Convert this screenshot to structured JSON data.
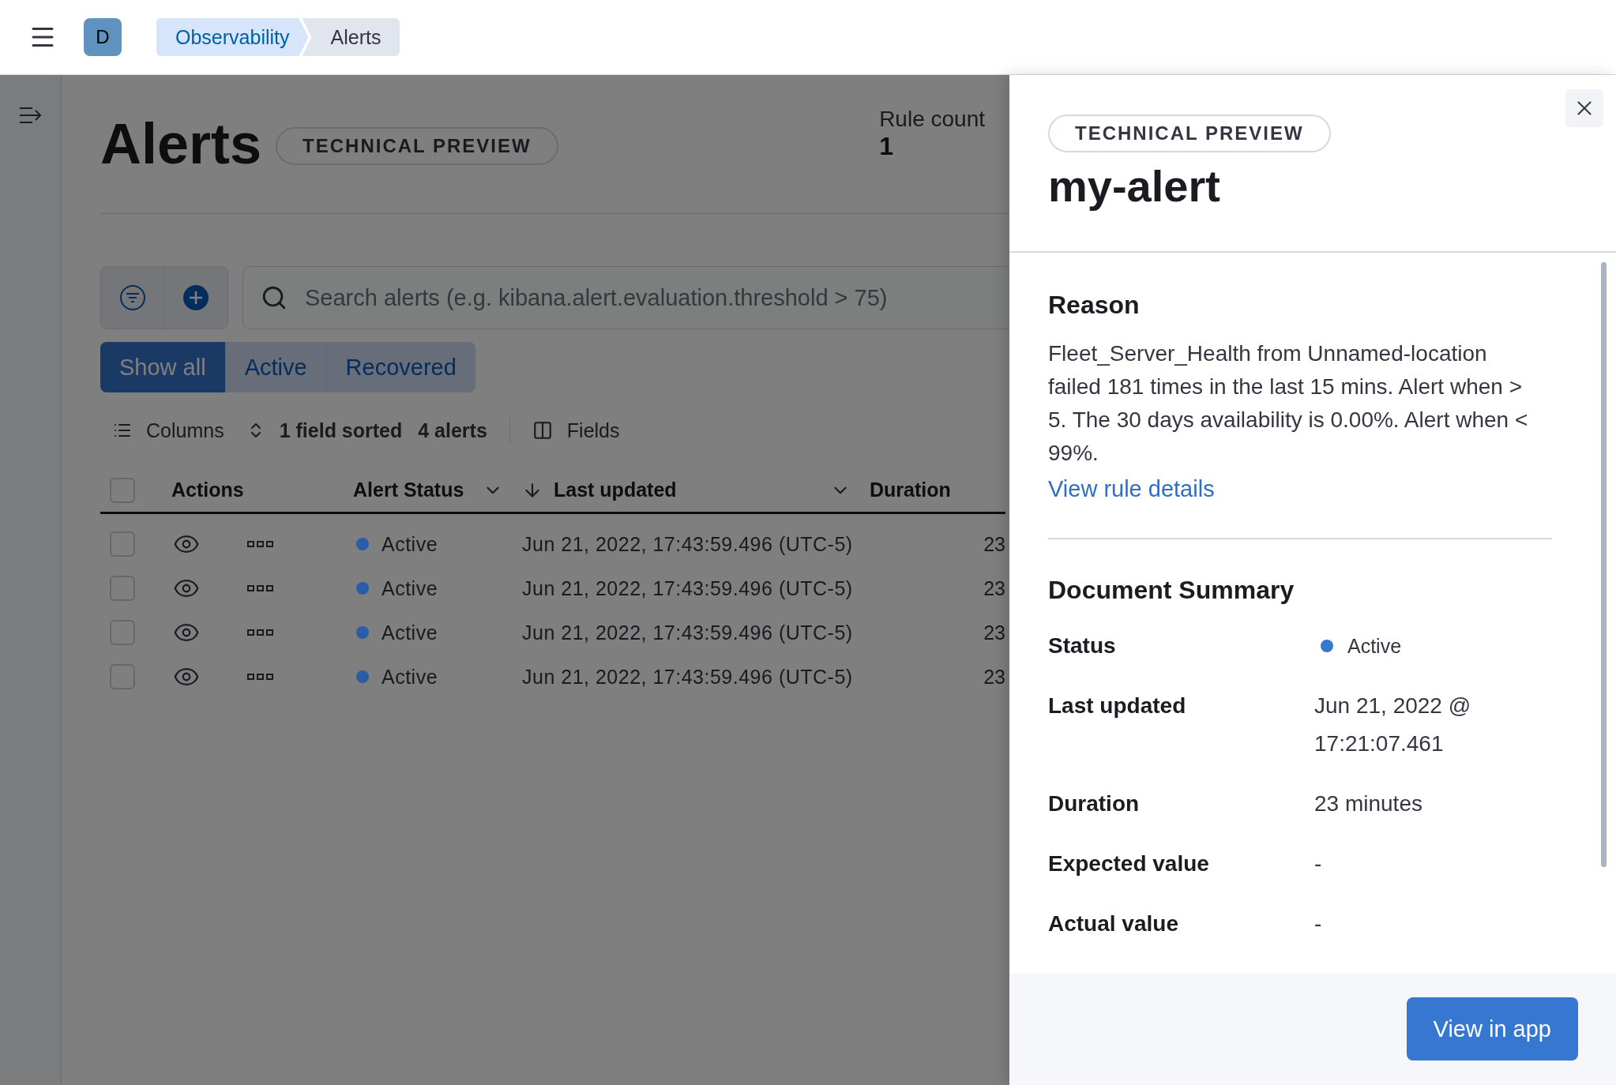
{
  "header": {
    "avatar": "D",
    "breadcrumbs": [
      {
        "label": "Observability",
        "selected": false
      },
      {
        "label": "Alerts",
        "selected": true
      }
    ]
  },
  "page": {
    "title": "Alerts",
    "badge": "TECHNICAL PREVIEW",
    "stats": [
      {
        "label": "Rule count",
        "value": "1"
      }
    ]
  },
  "search": {
    "placeholder": "Search alerts (e.g. kibana.alert.evaluation.threshold > 75)"
  },
  "filters": [
    {
      "label": "Show all",
      "selected": true
    },
    {
      "label": "Active",
      "selected": false
    },
    {
      "label": "Recovered",
      "selected": false
    }
  ],
  "toolbar": {
    "columns": "Columns",
    "sorted": "1 field sorted",
    "count": "4 alerts",
    "fields": "Fields"
  },
  "table": {
    "select_all_checked": false,
    "columns": [
      {
        "label": "Actions",
        "kind": "plain"
      },
      {
        "label": "Alert Status",
        "kind": "menu"
      },
      {
        "label": "Last updated",
        "kind": "sorted"
      },
      {
        "label": "Duration",
        "kind": "plain"
      }
    ],
    "rows": [
      {
        "checked": false,
        "status": "Active",
        "color": "#2a5da8",
        "updated": "Jun 21, 2022, 17:43:59.496 (UTC-5)",
        "duration": "23"
      },
      {
        "checked": false,
        "status": "Active",
        "color": "#2a5da8",
        "updated": "Jun 21, 2022, 17:43:59.496 (UTC-5)",
        "duration": "23"
      },
      {
        "checked": false,
        "status": "Active",
        "color": "#2a5da8",
        "updated": "Jun 21, 2022, 17:43:59.496 (UTC-5)",
        "duration": "23"
      },
      {
        "checked": false,
        "status": "Active",
        "color": "#2a5da8",
        "updated": "Jun 21, 2022, 17:43:59.496 (UTC-5)",
        "duration": "23"
      }
    ]
  },
  "flyout": {
    "badge": "TECHNICAL PREVIEW",
    "title": "my-alert",
    "reason_heading": "Reason",
    "reason": "Fleet_Server_Health from Unnamed-location failed 181 times in the last 15 mins. Alert when > 5. The 30 days availability is 0.00%. Alert when < 99%.",
    "link": "View rule details",
    "summary_heading": "Document Summary",
    "fields": [
      {
        "kind": "status",
        "label": "Status",
        "value": "Active",
        "color": "#3577d1"
      },
      {
        "kind": "text",
        "label": "Last updated",
        "value": "Jun 21, 2022 @ 17:21:07.461"
      },
      {
        "kind": "text",
        "label": "Duration",
        "value": "23 minutes"
      },
      {
        "kind": "text",
        "label": "Expected value",
        "value": "-"
      },
      {
        "kind": "text",
        "label": "Actual value",
        "value": "-"
      }
    ],
    "button": "View in app"
  }
}
